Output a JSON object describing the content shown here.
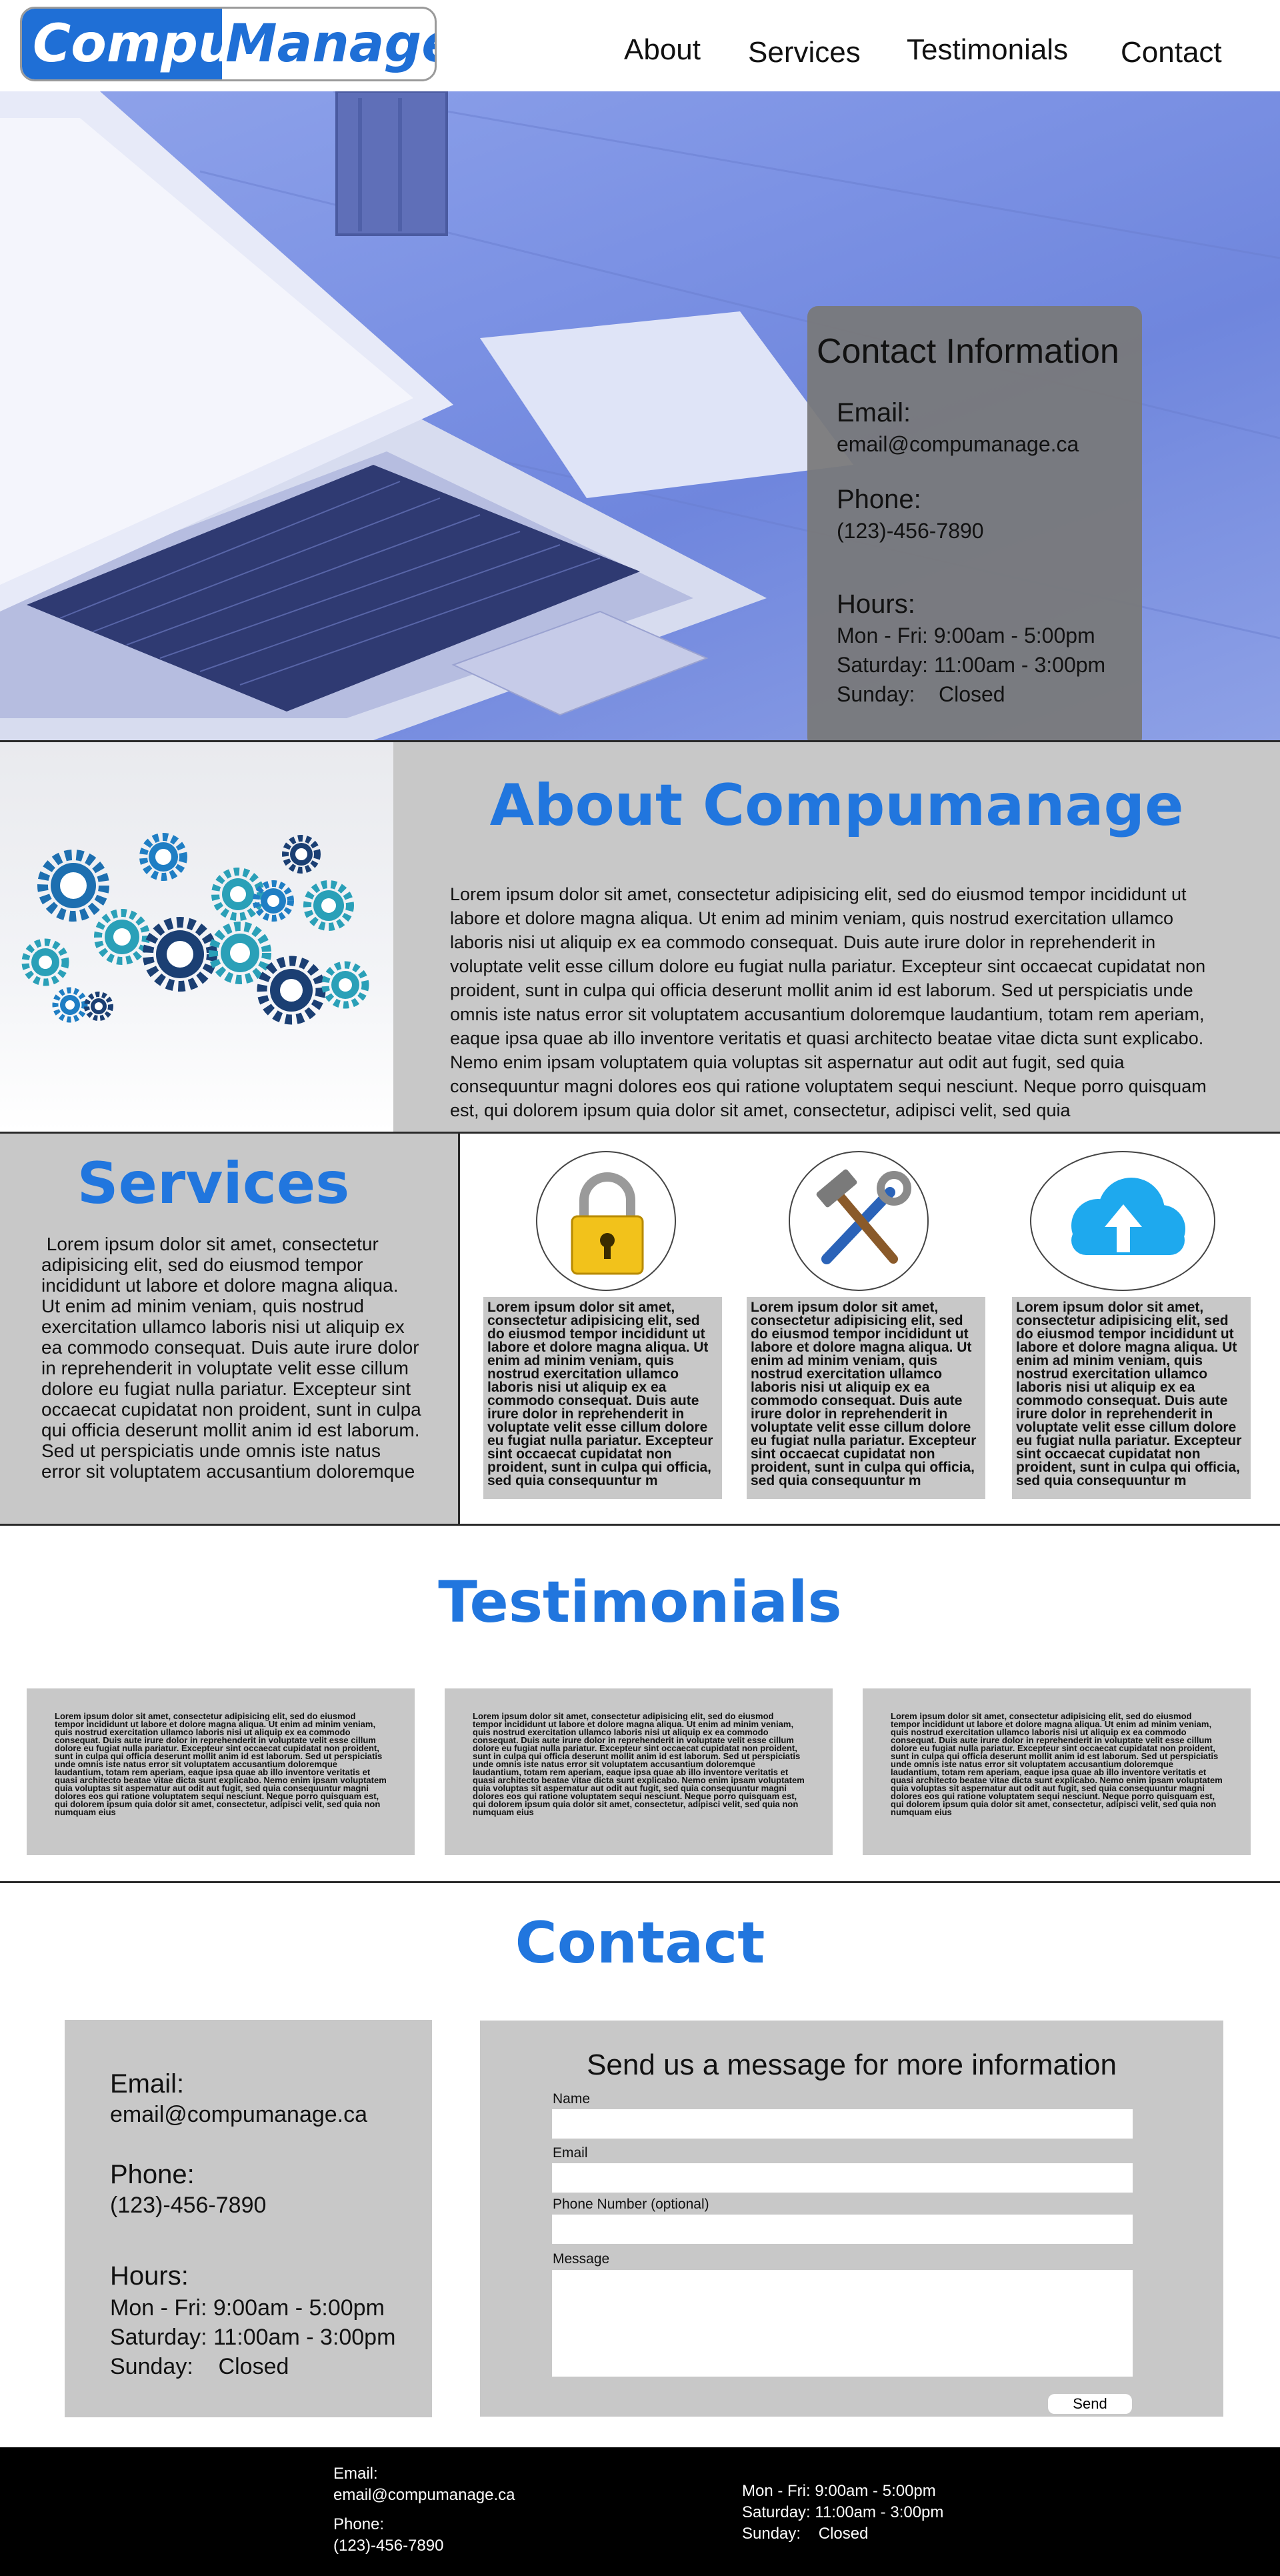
{
  "header": {
    "logo_part1": "Compu",
    "logo_part2": "Manage",
    "nav": [
      "About",
      "Services",
      "Testimonials",
      "Contact"
    ]
  },
  "contact_card": {
    "title": "Contact  Information",
    "email_label": "Email:",
    "email": "email@compumanage.ca",
    "phone_label": "Phone:",
    "phone": "(123)-456-7890",
    "hours_label": "Hours:",
    "hours": [
      "Mon - Fri: 9:00am - 5:00pm",
      "Saturday: 11:00am - 3:00pm",
      "Sunday:    Closed"
    ]
  },
  "about": {
    "title": "About Compumanage",
    "text": "Lorem ipsum dolor sit amet, consectetur adipisicing elit, sed do eiusmod tempor incididunt ut labore et dolore magna aliqua. Ut enim ad minim veniam, quis nostrud exercitation ullamco laboris nisi ut aliquip ex ea commodo consequat. Duis aute irure dolor in reprehenderit in voluptate velit esse cillum dolore eu fugiat nulla pariatur. Excepteur sint occaecat cupidatat non proident, sunt in culpa qui officia deserunt mollit anim id est laborum. Sed ut perspiciatis unde omnis iste natus error sit voluptatem accusantium doloremque laudantium, totam rem aperiam, eaque ipsa quae ab illo inventore veritatis et quasi architecto beatae vitae dicta sunt explicabo. Nemo enim ipsam voluptatem quia voluptas sit aspernatur aut odit aut fugit, sed quia consequuntur magni dolores eos qui ratione voluptatem sequi nesciunt. Neque porro quisquam est, qui dolorem ipsum quia dolor sit amet, consectetur, adipisci velit, sed quia"
  },
  "services": {
    "title": "Services",
    "text": " Lorem ipsum dolor sit amet, consectetur adipisicing elit, sed do eiusmod tempor incididunt ut labore et dolore magna aliqua. Ut enim ad minim veniam, quis nostrud exercitation ullamco laboris nisi ut aliquip ex ea commodo consequat. Duis aute irure dolor in reprehenderit in voluptate velit esse cillum dolore eu fugiat nulla pariatur. Excepteur sint occaecat cupidatat non proident, sunt in culpa qui officia deserunt mollit anim id est laborum. Sed ut perspiciatis unde omnis iste natus error sit voluptatem accusantium doloremque",
    "cards": [
      {
        "icon": "lock-icon",
        "text": "Lorem ipsum dolor sit amet, consectetur adipisicing elit, sed do eiusmod tempor incididunt ut labore et dolore magna aliqua. Ut enim ad minim veniam, quis nostrud exercitation ullamco laboris nisi ut aliquip ex ea commodo consequat. Duis aute irure dolor in reprehenderit in voluptate velit esse cillum dolore eu fugiat nulla pariatur. Excepteur sint occaecat cupidatat non proident, sunt in culpa qui officia, sed quia consequuntur m"
      },
      {
        "icon": "tools-icon",
        "text": "Lorem ipsum dolor sit amet, consectetur adipisicing elit, sed do eiusmod tempor incididunt ut labore et dolore magna aliqua. Ut enim ad minim veniam, quis nostrud exercitation ullamco laboris nisi ut aliquip ex ea commodo consequat. Duis aute irure dolor in reprehenderit in voluptate velit esse cillum dolore eu fugiat nulla pariatur. Excepteur sint occaecat cupidatat non proident, sunt in culpa qui officia, sed quia consequuntur m"
      },
      {
        "icon": "cloud-upload-icon",
        "text": "Lorem ipsum dolor sit amet, consectetur adipisicing elit, sed do eiusmod tempor incididunt ut labore et dolore magna aliqua. Ut enim ad minim veniam, quis nostrud exercitation ullamco laboris nisi ut aliquip ex ea commodo consequat. Duis aute irure dolor in reprehenderit in voluptate velit esse cillum dolore eu fugiat nulla pariatur. Excepteur sint occaecat cupidatat non proident, sunt in culpa qui officia, sed quia consequuntur m"
      }
    ]
  },
  "testimonials": {
    "title": "Testimonials",
    "cards": [
      "Lorem ipsum dolor sit amet, consectetur adipisicing elit, sed do eiusmod tempor incididunt ut labore et dolore magna aliqua. Ut enim ad minim veniam, quis nostrud exercitation ullamco laboris nisi ut aliquip ex ea commodo consequat. Duis aute irure dolor in reprehenderit in voluptate velit esse cillum dolore eu fugiat nulla pariatur. Excepteur sint occaecat cupidatat non proident, sunt in culpa qui officia deserunt mollit anim id est laborum. Sed ut perspiciatis unde omnis iste natus error sit voluptatem accusantium doloremque laudantium, totam rem aperiam, eaque ipsa quae ab illo inventore veritatis et quasi architecto beatae vitae dicta sunt explicabo. Nemo enim ipsam voluptatem quia voluptas sit aspernatur aut odit aut fugit, sed quia consequuntur magni dolores eos qui ratione voluptatem sequi nesciunt. Neque porro quisquam est, qui dolorem ipsum quia dolor sit amet, consectetur, adipisci velit, sed quia non numquam eius",
      "Lorem ipsum dolor sit amet, consectetur adipisicing elit, sed do eiusmod tempor incididunt ut labore et dolore magna aliqua. Ut enim ad minim veniam, quis nostrud exercitation ullamco laboris nisi ut aliquip ex ea commodo consequat. Duis aute irure dolor in reprehenderit in voluptate velit esse cillum dolore eu fugiat nulla pariatur. Excepteur sint occaecat cupidatat non proident, sunt in culpa qui officia deserunt mollit anim id est laborum. Sed ut perspiciatis unde omnis iste natus error sit voluptatem accusantium doloremque laudantium, totam rem aperiam, eaque ipsa quae ab illo inventore veritatis et quasi architecto beatae vitae dicta sunt explicabo. Nemo enim ipsam voluptatem quia voluptas sit aspernatur aut odit aut fugit, sed quia consequuntur magni dolores eos qui ratione voluptatem sequi nesciunt. Neque porro quisquam est, qui dolorem ipsum quia dolor sit amet, consectetur, adipisci velit, sed quia non numquam eius",
      "Lorem ipsum dolor sit amet, consectetur adipisicing elit, sed do eiusmod tempor incididunt ut labore et dolore magna aliqua. Ut enim ad minim veniam, quis nostrud exercitation ullamco laboris nisi ut aliquip ex ea commodo consequat. Duis aute irure dolor in reprehenderit in voluptate velit esse cillum dolore eu fugiat nulla pariatur. Excepteur sint occaecat cupidatat non proident, sunt in culpa qui officia deserunt mollit anim id est laborum. Sed ut perspiciatis unde omnis iste natus error sit voluptatem accusantium doloremque laudantium, totam rem aperiam, eaque ipsa quae ab illo inventore veritatis et quasi architecto beatae vitae dicta sunt explicabo. Nemo enim ipsam voluptatem quia voluptas sit aspernatur aut odit aut fugit, sed quia consequuntur magni dolores eos qui ratione voluptatem sequi nesciunt. Neque porro quisquam est, qui dolorem ipsum quia dolor sit amet, consectetur, adipisci velit, sed quia non numquam eius"
    ]
  },
  "contact": {
    "title": "Contact",
    "email_label": "Email:",
    "email": "email@compumanage.ca",
    "phone_label": "Phone:",
    "phone": "(123)-456-7890",
    "hours_label": "Hours:",
    "hours": [
      "Mon - Fri: 9:00am - 5:00pm",
      "Saturday: 11:00am - 3:00pm",
      "Sunday:    Closed"
    ],
    "form": {
      "title": "Send us a message for more information",
      "name_label": "Name",
      "email_label": "Email",
      "phone_label": "Phone Number (optional)",
      "message_label": "Message",
      "send_label": "Send"
    }
  },
  "footer": {
    "email_label": "Email:",
    "email": "email@compumanage.ca",
    "phone_label": "Phone:",
    "phone": "(123)-456-7890",
    "hours": [
      "Mon - Fri: 9:00am - 5:00pm",
      "Saturday: 11:00am - 3:00pm",
      "Sunday:    Closed"
    ]
  },
  "colors": {
    "brand_blue": "#2176de",
    "panel_gray": "#c8c8c8",
    "hero_tint": "#7c92e4",
    "footer_bg": "#000000"
  }
}
